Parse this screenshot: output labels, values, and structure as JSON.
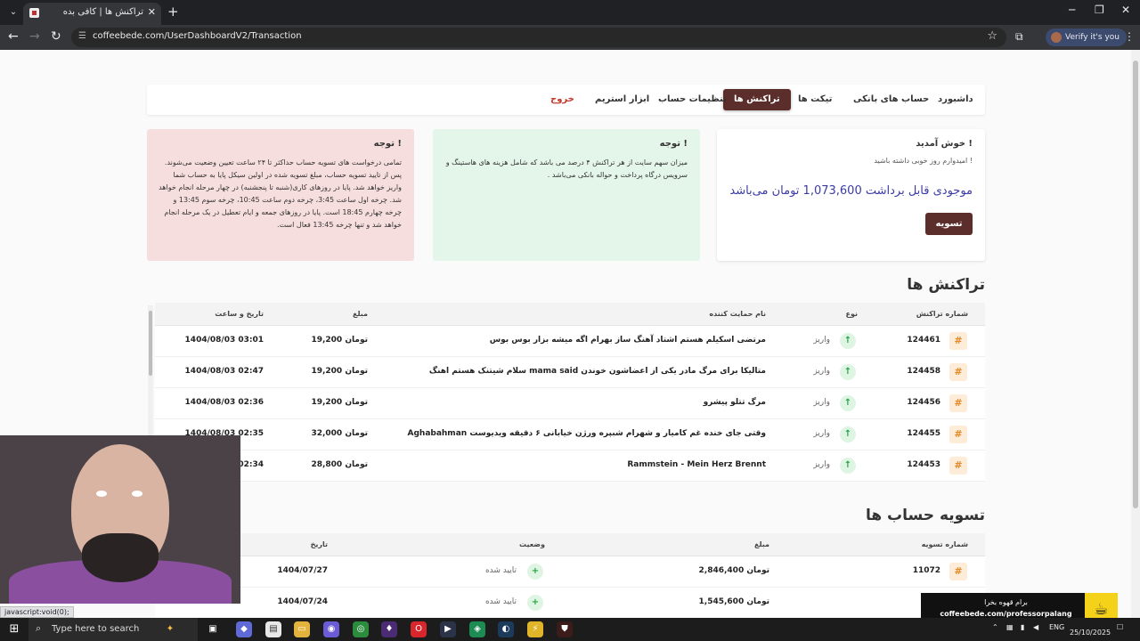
{
  "browser": {
    "tab_title": "تراکنش ها | کافی بده",
    "tab_close": "✕",
    "new_tab": "+",
    "url": "coffeebede.com/UserDashboardV2/Transaction",
    "profile_label": "Verify it's you",
    "status_url": "javascript:void(0);"
  },
  "nav": {
    "dashboard": "داشبورد",
    "bank_accounts": "حساب های بانکی",
    "tickets": "تیکت ها",
    "transactions": "تراکنش ها",
    "account_settings": "تنظیمات حساب",
    "stream_tools": "ابزار استریم",
    "logout": "خروج"
  },
  "welcome": {
    "title": "خوش آمدید !",
    "subtitle": "امیدوارم روز خوبی داشته باشید !",
    "balance": "موجودی قابل برداشت 1,073,600 تومان می‌باشد",
    "settle_button": "تسویه"
  },
  "note_fee": {
    "title": "توجه !",
    "body": "میزان سهم سایت از هر تراکنش ۴ درصد می باشد که شامل هزینه های هاستینگ و سرویس درگاه پرداخت و حواله بانکی می‌باشد ."
  },
  "note_settlement": {
    "title": "توجه !",
    "body": "تمامی درخواست های تسویه حساب حداکثر تا ۲۴ ساعت تعیین وضعیت می‌شوند. پس از تایید تسویه حساب، مبلغ تسویه شده در اولین سیکل پایا به حساب شما واریز خواهد شد. پایا در روزهای کاری(شنبه تا پنجشنبه) در چهار مرحله انجام خواهد شد. چرخه اول ساعت 3:45، چرخه دوم ساعت 10:45، چرخه سوم 13:45 و چرخه چهارم 18:45 است. پایا در روزهای جمعه و ایام تعطیل در یک مرحله انجام خواهد شد و تنها چرخه 13:45 فعال است."
  },
  "transactions": {
    "title": "تراکنش ها",
    "headers": {
      "id": "شماره تراکنش",
      "type": "نوع",
      "supporter": "نام حمایت کننده",
      "amount": "مبلغ",
      "datetime": "تاریخ و ساعت"
    },
    "rows": [
      {
        "id": "124461",
        "type": "واریز",
        "supporter": "مرتضی اسکیلم هستم اشتاد آهنگ ساز بهرام اگه میشه بزار بوس بوس",
        "amount": "19,200 تومان",
        "datetime": "1404/08/03 03:01"
      },
      {
        "id": "124458",
        "type": "واریز",
        "supporter": "سلام شیتنک هستم اهنگ mama said متالیکا برای مرگ مادر یکی از اعضاشون خوندن",
        "amount": "19,200 تومان",
        "datetime": "1404/08/03 02:47"
      },
      {
        "id": "124456",
        "type": "واریز",
        "supporter": "مرگ تتلو پیشرو",
        "amount": "19,200 تومان",
        "datetime": "1404/08/03 02:36"
      },
      {
        "id": "124455",
        "type": "واریز",
        "supporter": "Aghabahman وقتی جای خنده غم کامیار و شهرام شبپره ورژن خیابانی ۶ دقیقه ویدیوست",
        "amount": "32,000 تومان",
        "datetime": "1404/08/03 02:35"
      },
      {
        "id": "124453",
        "type": "واریز",
        "supporter": "Rammstein - Mein Herz Brennt",
        "amount": "28,800 تومان",
        "datetime": "02:34"
      }
    ]
  },
  "settlements": {
    "title": "تسویه حساب ها",
    "headers": {
      "id": "شماره تسویه",
      "amount": "مبلغ",
      "status": "وضعیت",
      "date": "تاریخ"
    },
    "rows": [
      {
        "id": "11072",
        "amount": "2,846,400 تومان",
        "status": "تایید شده",
        "date": "1404/07/27"
      },
      {
        "amount": "1,545,600 تومان",
        "status": "تایید شده",
        "date": "1404/07/24"
      }
    ]
  },
  "promo": {
    "line1": "برام قهوه بخرا",
    "line2": "coffeebede.com/professorpalang"
  },
  "taskbar": {
    "search_placeholder": "Type here to search",
    "lang": "ENG",
    "date": "25/10/2025"
  }
}
